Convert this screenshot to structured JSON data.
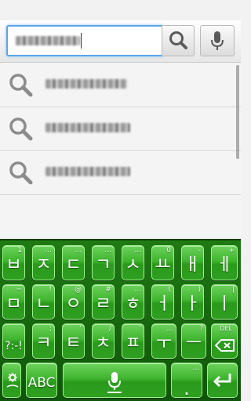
{
  "search": {
    "placeholder": "",
    "value_blurred": true
  },
  "icons": {
    "search": "magnifier-icon",
    "voice": "microphone-icon",
    "suggestion": "magnifier-icon",
    "delete": "backspace-icon",
    "enter": "enter-arrow-icon",
    "settings": "settings-gear-icon"
  },
  "colors": {
    "keyboard_bg": "#1f7a14",
    "key_face": "#3fb52f",
    "focus_border": "#5aa7e8"
  },
  "suggestions": [
    {
      "text_blurred": true
    },
    {
      "text_blurred": true
    },
    {
      "text_blurred": true
    }
  ],
  "keyboard": {
    "row1": [
      {
        "main": "ㅂ",
        "hint": "1"
      },
      {
        "main": "ㅈ",
        "hint": "..."
      },
      {
        "main": "ㄷ",
        "hint": "..."
      },
      {
        "main": "ㄱ",
        "hint": "..."
      },
      {
        "main": "ㅅ",
        "hint": "..."
      },
      {
        "main": "ㅛ",
        "hint": "0"
      },
      {
        "main": "ㅐ",
        "hint": "-"
      },
      {
        "main": "ㅔ",
        "hint": "+"
      }
    ],
    "row2": [
      {
        "main": "ㅁ",
        "hint": "~"
      },
      {
        "main": "ㄴ",
        "hint": "!"
      },
      {
        "main": "ㅇ",
        "hint": "@"
      },
      {
        "main": "ㄹ",
        "hint": "#"
      },
      {
        "main": "ㅎ",
        "hint": "..."
      },
      {
        "main": "ㅓ",
        "hint": "("
      },
      {
        "main": "ㅏ",
        "hint": ")"
      },
      {
        "main": "ㅣ",
        "hint": "|"
      }
    ],
    "row3": [
      {
        "main": "?:-!",
        "hint": ""
      },
      {
        "main": "ㅋ",
        "hint": ";"
      },
      {
        "main": "ㅌ",
        "hint": "'"
      },
      {
        "main": "ㅊ",
        "hint": "/"
      },
      {
        "main": "ㅍ",
        "hint": "'"
      },
      {
        "main": "ㅜ",
        "hint": "..."
      },
      {
        "main": "ㅡ",
        "hint": "?"
      },
      {
        "main": "",
        "hint": "DEL"
      }
    ],
    "row4": {
      "settings_hint": "",
      "abc_label": "ABC",
      "space_label": "",
      "period_label": ".",
      "period_hint": "...",
      "enter_label": ""
    }
  }
}
